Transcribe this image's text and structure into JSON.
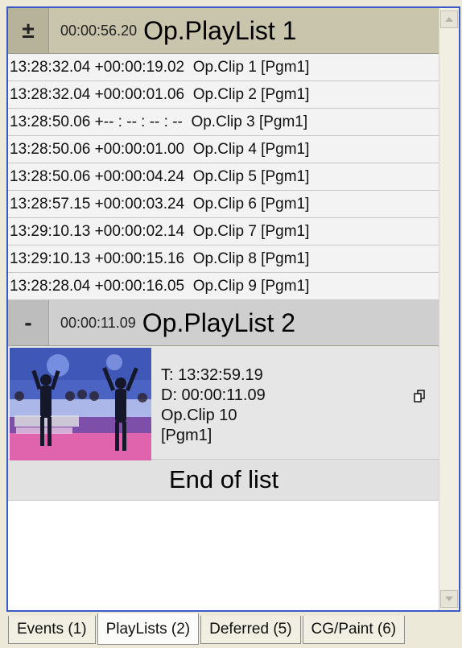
{
  "playlist1": {
    "toggle": "±",
    "duration": "00:00:56.20",
    "name": "Op.PlayList 1",
    "clips": [
      {
        "time": "13:28:32.04",
        "offset": "+00:00:19.02",
        "name": "Op.Clip 1",
        "channel": "[Pgm1]"
      },
      {
        "time": "13:28:32.04",
        "offset": "+00:00:01.06",
        "name": "Op.Clip 2",
        "channel": "[Pgm1]"
      },
      {
        "time": "13:28:50.06",
        "offset": "+-- : -- : -- : --",
        "name": "Op.Clip 3",
        "channel": "[Pgm1]"
      },
      {
        "time": "13:28:50.06",
        "offset": "+00:00:01.00",
        "name": "Op.Clip 4",
        "channel": "[Pgm1]"
      },
      {
        "time": "13:28:50.06",
        "offset": "+00:00:04.24",
        "name": "Op.Clip 5",
        "channel": "[Pgm1]"
      },
      {
        "time": "13:28:57.15",
        "offset": "+00:00:03.24",
        "name": "Op.Clip 6",
        "channel": "[Pgm1]"
      },
      {
        "time": "13:29:10.13",
        "offset": "+00:00:02.14",
        "name": "Op.Clip 7",
        "channel": "[Pgm1]"
      },
      {
        "time": "13:29:10.13",
        "offset": "+00:00:15.16",
        "name": "Op.Clip 8",
        "channel": "[Pgm1]"
      },
      {
        "time": "13:28:28.04",
        "offset": "+00:00:16.05",
        "name": "Op.Clip 9",
        "channel": "[Pgm1]"
      }
    ]
  },
  "playlist2": {
    "toggle": "-",
    "duration": "00:00:11.09",
    "name": "Op.PlayList 2",
    "clip": {
      "time_line": "T: 13:32:59.19",
      "duration_line": "D: 00:00:11.09",
      "name": "Op.Clip 10",
      "channel": "[Pgm1]",
      "thumbnail_icon": "video-thumbnail",
      "action_icon": "dual-rectangle-icon"
    }
  },
  "end_text": "End of list",
  "tabs": [
    {
      "label": "Events (1)",
      "active": false
    },
    {
      "label": "PlayLists (2)",
      "active": true
    },
    {
      "label": "Deferred (5)",
      "active": false
    },
    {
      "label": "CG/Paint (6)",
      "active": false
    }
  ],
  "colors": {
    "frame_border": "#3a5ac8",
    "playlist_header": "#c8c5ac",
    "row_bg": "#f3f3f3"
  }
}
